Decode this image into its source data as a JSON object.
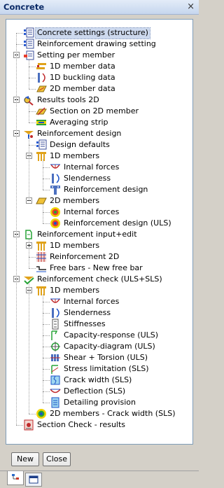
{
  "window": {
    "title": "Concrete",
    "close_glyph": "×"
  },
  "tree": [
    {
      "label": "Concrete settings (structure)",
      "level": 1,
      "icon": "settings-sheet-icon",
      "selected": true
    },
    {
      "label": "Reinforcement drawing setting",
      "level": 1,
      "icon": "settings-sheet-icon"
    },
    {
      "label": "Setting per member",
      "level": 1,
      "icon": "member-settings-icon",
      "expander": "minus"
    },
    {
      "label": "1D member data",
      "level": 2,
      "icon": "member-1d-data-icon"
    },
    {
      "label": "1D buckling data",
      "level": 2,
      "icon": "buckling-data-icon"
    },
    {
      "label": "2D member data",
      "level": 2,
      "icon": "member-2d-data-icon"
    },
    {
      "label": "Results tools 2D",
      "level": 1,
      "icon": "results-tools-icon",
      "expander": "minus"
    },
    {
      "label": "Section on 2D member",
      "level": 2,
      "icon": "section-2d-icon"
    },
    {
      "label": "Averaging strip",
      "level": 2,
      "icon": "averaging-strip-icon"
    },
    {
      "label": "Reinforcement design",
      "level": 1,
      "icon": "reinforcement-design-icon",
      "expander": "minus"
    },
    {
      "label": "Design defaults",
      "level": 2,
      "icon": "settings-sheet-icon"
    },
    {
      "label": "1D members",
      "level": 2,
      "icon": "members-1d-icon",
      "expander": "minus"
    },
    {
      "label": "Internal forces",
      "level": 3,
      "icon": "internal-forces-icon"
    },
    {
      "label": "Slenderness",
      "level": 3,
      "icon": "slenderness-icon"
    },
    {
      "label": "Reinforcement design",
      "level": 3,
      "icon": "beam-reinforcement-icon"
    },
    {
      "label": "2D members",
      "level": 2,
      "icon": "members-2d-icon",
      "expander": "minus"
    },
    {
      "label": "Internal forces",
      "level": 3,
      "icon": "internal-forces-2d-icon"
    },
    {
      "label": "Reinforcement design (ULS)",
      "level": 3,
      "icon": "reinforcement-2d-uls-icon"
    },
    {
      "label": "Reinforcement input+edit",
      "level": 1,
      "icon": "reinforcement-input-icon",
      "expander": "minus"
    },
    {
      "label": "1D members",
      "level": 2,
      "icon": "members-1d-icon",
      "expander": "plus"
    },
    {
      "label": "Reinforcement 2D",
      "level": 2,
      "icon": "reinforcement-2d-icon"
    },
    {
      "label": "Free bars - New free bar",
      "level": 2,
      "icon": "free-bar-icon"
    },
    {
      "label": "Reinforcement check (ULS+SLS)",
      "level": 1,
      "icon": "reinforcement-check-icon",
      "expander": "minus"
    },
    {
      "label": "1D members",
      "level": 2,
      "icon": "members-1d-icon",
      "expander": "minus"
    },
    {
      "label": "Internal forces",
      "level": 3,
      "icon": "internal-forces-icon"
    },
    {
      "label": "Slenderness",
      "level": 3,
      "icon": "slenderness-icon"
    },
    {
      "label": "Stiffnesses",
      "level": 3,
      "icon": "stiffness-icon"
    },
    {
      "label": "Capacity-response (ULS)",
      "level": 3,
      "icon": "capacity-response-icon"
    },
    {
      "label": "Capacity-diagram (ULS)",
      "level": 3,
      "icon": "capacity-diagram-icon"
    },
    {
      "label": "Shear + Torsion (ULS)",
      "level": 3,
      "icon": "shear-torsion-icon"
    },
    {
      "label": "Stress limitation (SLS)",
      "level": 3,
      "icon": "stress-limitation-icon"
    },
    {
      "label": "Crack width (SLS)",
      "level": 3,
      "icon": "crack-width-icon"
    },
    {
      "label": "Deflection (SLS)",
      "level": 3,
      "icon": "deflection-icon"
    },
    {
      "label": "Detailing provision",
      "level": 3,
      "icon": "detailing-provision-icon"
    },
    {
      "label": "2D members - Crack width (SLS)",
      "level": 2,
      "icon": "members-2d-crack-icon"
    },
    {
      "label": "Section Check - results",
      "level": 1,
      "icon": "section-check-icon"
    }
  ],
  "buttons": {
    "new": "New",
    "close": "Close"
  },
  "tabs": [
    {
      "icon": "tree-view-tab-icon"
    },
    {
      "icon": "window-tab-icon"
    }
  ]
}
